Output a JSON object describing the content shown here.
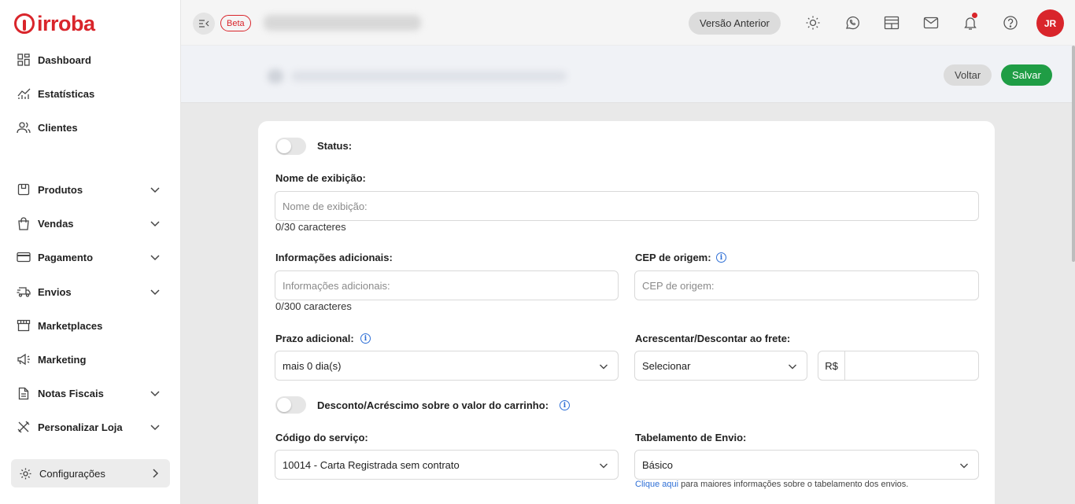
{
  "brand": {
    "name": "irroba",
    "color": "#d9252b"
  },
  "sidebar": {
    "items": [
      {
        "label": "Dashboard",
        "icon": "dashboard-icon"
      },
      {
        "label": "Estatísticas",
        "icon": "chart-line-icon"
      },
      {
        "label": "Clientes",
        "icon": "users-icon"
      },
      {
        "label": "Produtos",
        "icon": "box-icon",
        "has_children": true
      },
      {
        "label": "Vendas",
        "icon": "shopping-bag-icon",
        "has_children": true
      },
      {
        "label": "Pagamento",
        "icon": "credit-card-icon",
        "has_children": true
      },
      {
        "label": "Envios",
        "icon": "truck-icon",
        "has_children": true
      },
      {
        "label": "Marketplaces",
        "icon": "store-icon"
      },
      {
        "label": "Marketing",
        "icon": "megaphone-icon"
      },
      {
        "label": "Notas Fiscais",
        "icon": "invoice-icon",
        "has_children": true
      },
      {
        "label": "Personalizar Loja",
        "icon": "tools-icon",
        "has_children": true
      },
      {
        "label": "Configurações",
        "icon": "gear-icon",
        "active": true
      }
    ]
  },
  "topbar": {
    "beta_label": "Beta",
    "previous_version_label": "Versão Anterior",
    "avatar_initials": "JR",
    "icons": [
      "sun-icon",
      "whatsapp-icon",
      "layout-icon",
      "mail-icon",
      "bell-icon",
      "help-icon"
    ]
  },
  "actions": {
    "back_label": "Voltar",
    "save_label": "Salvar",
    "save_color": "#1f9d45"
  },
  "form": {
    "status_label": "Status:",
    "display_name": {
      "label": "Nome de exibição:",
      "placeholder": "Nome de exibição:",
      "counter": "0/30 caracteres"
    },
    "additional_info": {
      "label": "Informações adicionais:",
      "placeholder": "Informações adicionais:",
      "counter": "0/300 caracteres"
    },
    "origin_cep": {
      "label": "CEP de origem:",
      "placeholder": "CEP de origem:"
    },
    "extra_time": {
      "label": "Prazo adicional:",
      "value": "mais 0 dia(s)"
    },
    "freight_adjust": {
      "label": "Acrescentar/Descontar ao frete:",
      "select_value": "Selecionar",
      "currency_prefix": "R$",
      "amount": ""
    },
    "cart_discount_label": "Desconto/Acréscimo sobre o valor do carrinho:",
    "service_code": {
      "label": "Código do serviço:",
      "value": "10014 - Carta Registrada sem contrato"
    },
    "shipping_table": {
      "label": "Tabelamento de Envio:",
      "value": "Básico",
      "help_link": "Clique aqui",
      "help_text": " para maiores informações sobre o tabelamento dos envios."
    }
  }
}
